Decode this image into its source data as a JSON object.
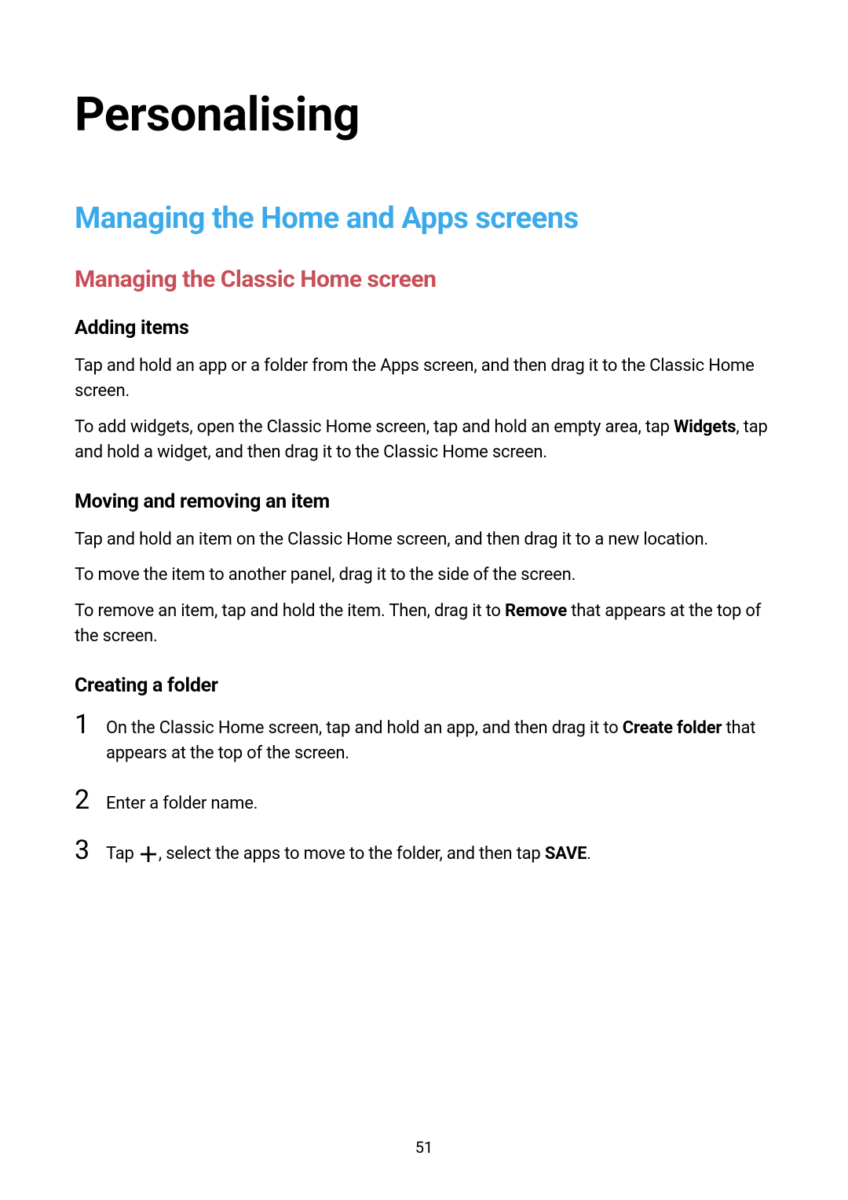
{
  "page": {
    "title": "Personalising",
    "number": "51"
  },
  "h2": "Managing the Home and Apps screens",
  "h3": "Managing the Classic Home screen",
  "sec1": {
    "heading": "Adding items",
    "p1": "Tap and hold an app or a folder from the Apps screen, and then drag it to the Classic Home screen.",
    "p2_pre": "To add widgets, open the Classic Home screen, tap and hold an empty area, tap ",
    "p2_bold": "Widgets",
    "p2_post": ", tap and hold a widget, and then drag it to the Classic Home screen."
  },
  "sec2": {
    "heading": "Moving and removing an item",
    "p1": "Tap and hold an item on the Classic Home screen, and then drag it to a new location.",
    "p2": "To move the item to another panel, drag it to the side of the screen.",
    "p3_pre": "To remove an item, tap and hold the item. Then, drag it to ",
    "p3_bold": "Remove",
    "p3_post": " that appears at the top of the screen."
  },
  "sec3": {
    "heading": "Creating a folder",
    "steps": {
      "s1_num": "1",
      "s1_pre": "On the Classic Home screen, tap and hold an app, and then drag it to ",
      "s1_bold": "Create folder",
      "s1_post": " that appears at the top of the screen.",
      "s2_num": "2",
      "s2_text": "Enter a folder name.",
      "s3_num": "3",
      "s3_pre": "Tap ",
      "s3_mid": ", select the apps to move to the folder, and then tap ",
      "s3_bold": "SAVE",
      "s3_post": "."
    }
  }
}
